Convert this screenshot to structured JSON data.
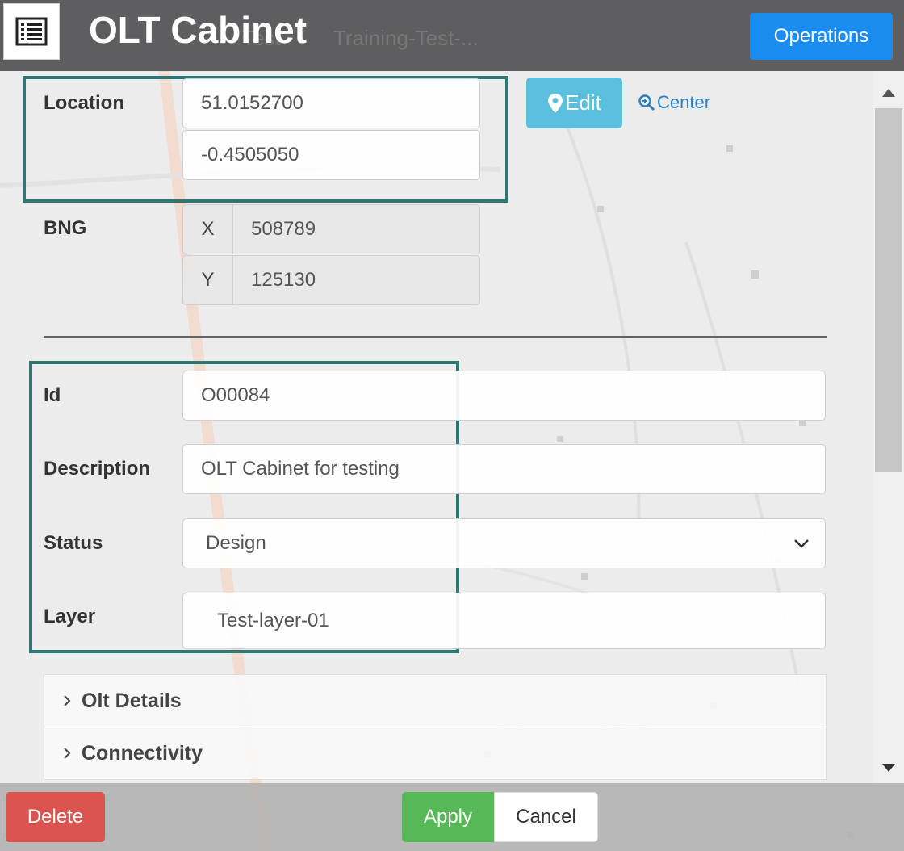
{
  "header": {
    "title": "OLT Cabinet",
    "background_text_1": "Test",
    "background_text_2": "Training-Test-...",
    "operations_label": "Operations",
    "menu_icon": "list-icon"
  },
  "location": {
    "label": "Location",
    "latitude": "51.0152700",
    "longitude": "-0.4505050",
    "edit_label": "Edit",
    "edit_icon": "map-marker-icon",
    "center_label": "Center",
    "center_icon": "zoom-in-icon"
  },
  "bng": {
    "label": "BNG",
    "x_addon": "X",
    "x_value": "508789",
    "y_addon": "Y",
    "y_value": "125130"
  },
  "fields": {
    "id_label": "Id",
    "id_value": "O00084",
    "description_label": "Description",
    "description_value": "OLT Cabinet for testing",
    "status_label": "Status",
    "status_value": "Design",
    "layer_label": "Layer",
    "layer_value": "Test-layer-01"
  },
  "accordions": [
    {
      "label": "Olt Details"
    },
    {
      "label": "Connectivity"
    }
  ],
  "footer": {
    "delete_label": "Delete",
    "apply_label": "Apply",
    "cancel_label": "Cancel"
  },
  "colors": {
    "header_bg": "#5e5e60",
    "operations_btn": "#1a8cf0",
    "edit_btn": "#5bc0de",
    "delete_btn": "#dc5450",
    "apply_btn": "#56b856",
    "highlight_border": "#2f7775",
    "link": "#2d7fc0"
  }
}
